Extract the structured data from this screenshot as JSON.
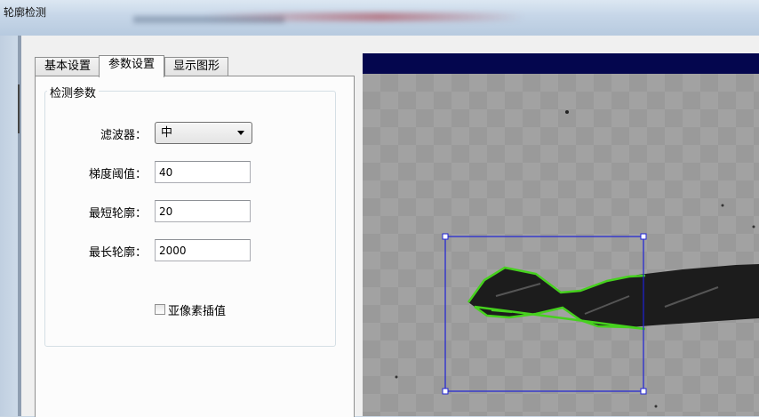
{
  "window": {
    "title": "轮廓检测"
  },
  "tabs": [
    {
      "label": "基本设置",
      "active": false
    },
    {
      "label": "参数设置",
      "active": true
    },
    {
      "label": "显示图形",
      "active": false
    }
  ],
  "params": {
    "group_title": "检测参数",
    "filter": {
      "label": "滤波器：",
      "value": "中"
    },
    "gradient_threshold": {
      "label": "梯度阈值：",
      "value": "40"
    },
    "min_contour": {
      "label": "最短轮廓：",
      "value": "20"
    },
    "max_contour": {
      "label": "最长轮廓：",
      "value": "2000"
    },
    "subpixel": {
      "label": "亚像素插值",
      "checked": false
    }
  },
  "colors": {
    "viewer_header": "#04064e",
    "roi_box": "#1e22d6",
    "contour": "#46d11e"
  }
}
